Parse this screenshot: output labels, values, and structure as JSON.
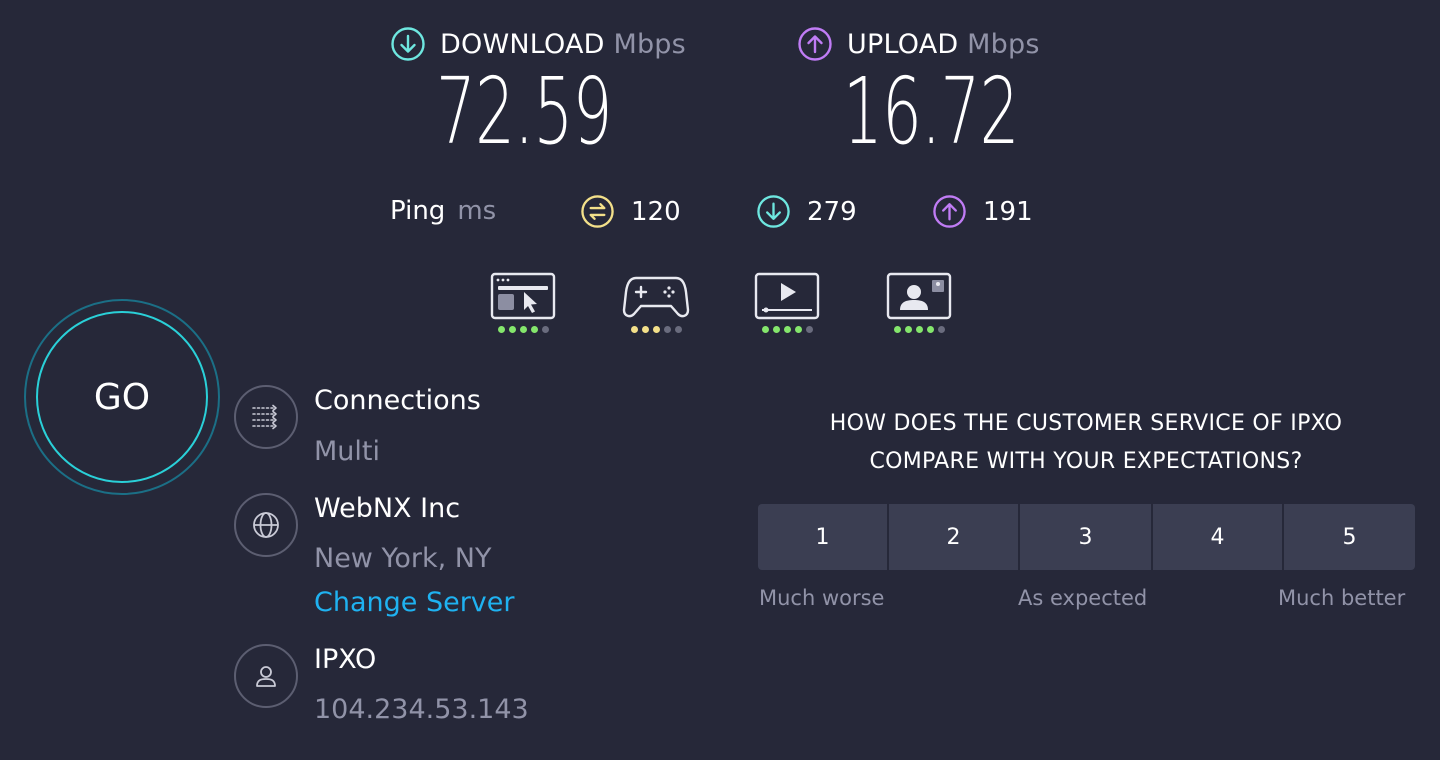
{
  "download": {
    "label": "DOWNLOAD",
    "unit": "Mbps",
    "value": "72.59",
    "color": "#6ee7e0"
  },
  "upload": {
    "label": "UPLOAD",
    "unit": "Mbps",
    "value": "16.72",
    "color": "#c07cf5"
  },
  "ping": {
    "label": "Ping",
    "unit": "ms",
    "idle": "120",
    "download": "279",
    "upload": "191",
    "idle_color": "#f3e08a"
  },
  "quality": [
    {
      "icon": "browsing-icon",
      "level": 4,
      "max": 5,
      "rating_color": "green"
    },
    {
      "icon": "gaming-icon",
      "level": 3,
      "max": 5,
      "rating_color": "yellow"
    },
    {
      "icon": "video-streaming-icon",
      "level": 4,
      "max": 5,
      "rating_color": "green"
    },
    {
      "icon": "video-chat-icon",
      "level": 4,
      "max": 5,
      "rating_color": "green"
    }
  ],
  "go_label": "GO",
  "connections": {
    "title": "Connections",
    "value": "Multi"
  },
  "server": {
    "name": "WebNX Inc",
    "location": "New York, NY",
    "change_label": "Change Server"
  },
  "provider": {
    "name": "IPXO",
    "ip": "104.234.53.143"
  },
  "survey": {
    "question_line1": "HOW DOES THE CUSTOMER SERVICE OF IPXO",
    "question_line2": "COMPARE WITH YOUR EXPECTATIONS?",
    "options": [
      "1",
      "2",
      "3",
      "4",
      "5"
    ],
    "low_label": "Much worse",
    "mid_label": "As expected",
    "high_label": "Much better"
  }
}
